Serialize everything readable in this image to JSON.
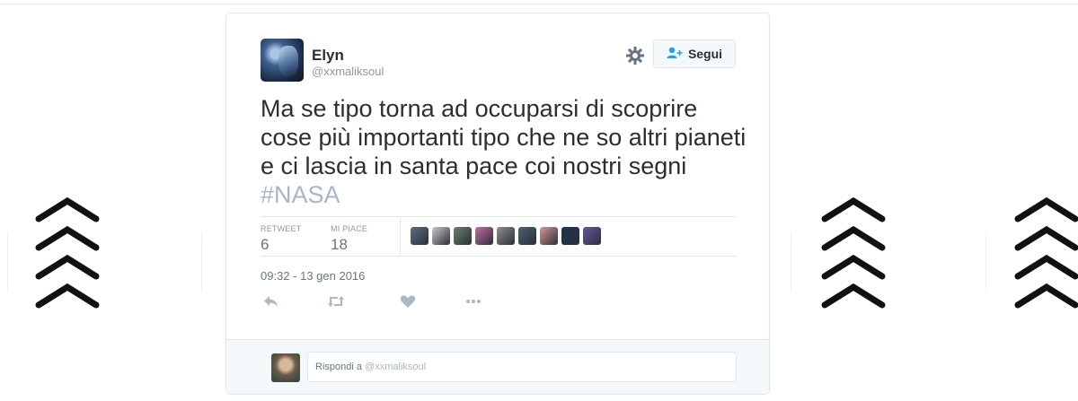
{
  "tweet": {
    "author_name": "Elyn",
    "author_handle": "@xxmaliksoul",
    "follow_label": "Segui",
    "text_lines": [
      "Ma se tipo torna ad occuparsi di scoprire",
      "cose più importanti tipo che ne so altri pianeti",
      "e ci lascia in santa pace coi nostri segni"
    ],
    "hashtag": "#NASA",
    "stats": {
      "retweet_label": "RETWEET",
      "retweet_count": "6",
      "likes_label": "MI PIACE",
      "likes_count": "18"
    },
    "timestamp": "09:32 - 13 gen 2016",
    "likers_colors": [
      "#5b6f86",
      "#c9c9c9",
      "#6e7f6a",
      "#c56ca8",
      "#8f8f8f",
      "#4c6074",
      "#d49a9a",
      "#1f3550",
      "#6a55a5"
    ]
  },
  "reply": {
    "prefix": "Rispondi a ",
    "handle": "@xxmaliksoul"
  },
  "colors": {
    "accent": "#1da1f2",
    "muted": "#8899a6",
    "hashtag": "#a9b7c3"
  },
  "icons": [
    "gear-icon",
    "follow-user-icon",
    "reply-icon",
    "retweet-icon",
    "like-icon",
    "more-icon",
    "chevron-stack-icon"
  ]
}
